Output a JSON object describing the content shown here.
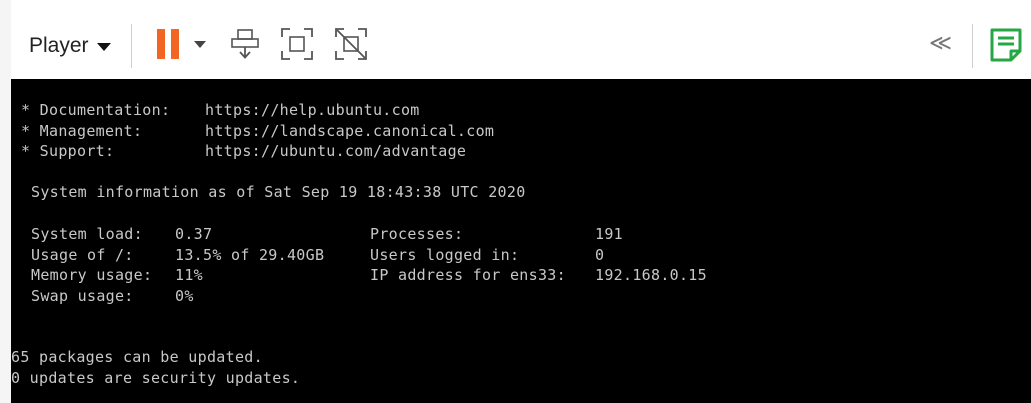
{
  "toolbar": {
    "player_label": "Player",
    "icons": {
      "player_menu": "chevron-down-icon",
      "pause": "pause-icon",
      "pause_menu": "chevron-down-icon",
      "send_keys": "send-ctrl-alt-del-icon",
      "fullscreen": "fullscreen-icon",
      "unity": "unity-icon",
      "collapse": "double-chevron-left-icon",
      "notes": "notes-icon"
    },
    "colors": {
      "pause_accent": "#f26522",
      "notes_accent": "#27a744",
      "icon_gray": "#555555"
    },
    "collapse_glyph": "≪"
  },
  "terminal": {
    "background": "#000000",
    "foreground": "#c8c8c8",
    "links": [
      {
        "label": "* Documentation:",
        "value": "https://help.ubuntu.com"
      },
      {
        "label": "* Management:",
        "value": "https://landscape.canonical.com"
      },
      {
        "label": "* Support:",
        "value": "https://ubuntu.com/advantage"
      }
    ],
    "sysinfo_heading": "System information as of Sat Sep 19 18:43:38 UTC 2020",
    "stats_left": [
      {
        "label": "System load:",
        "value": "0.37"
      },
      {
        "label": "Usage of /:",
        "value": "13.5% of 29.40GB"
      },
      {
        "label": "Memory usage:",
        "value": "11%"
      },
      {
        "label": "Swap usage:",
        "value": "0%"
      }
    ],
    "stats_right": [
      {
        "label": "Processes:",
        "value": "191"
      },
      {
        "label": "Users logged in:",
        "value": "0"
      },
      {
        "label": "IP address for ens33:",
        "value": "192.168.0.15"
      }
    ],
    "updates": [
      "65 packages can be updated.",
      "0 updates are security updates."
    ]
  }
}
